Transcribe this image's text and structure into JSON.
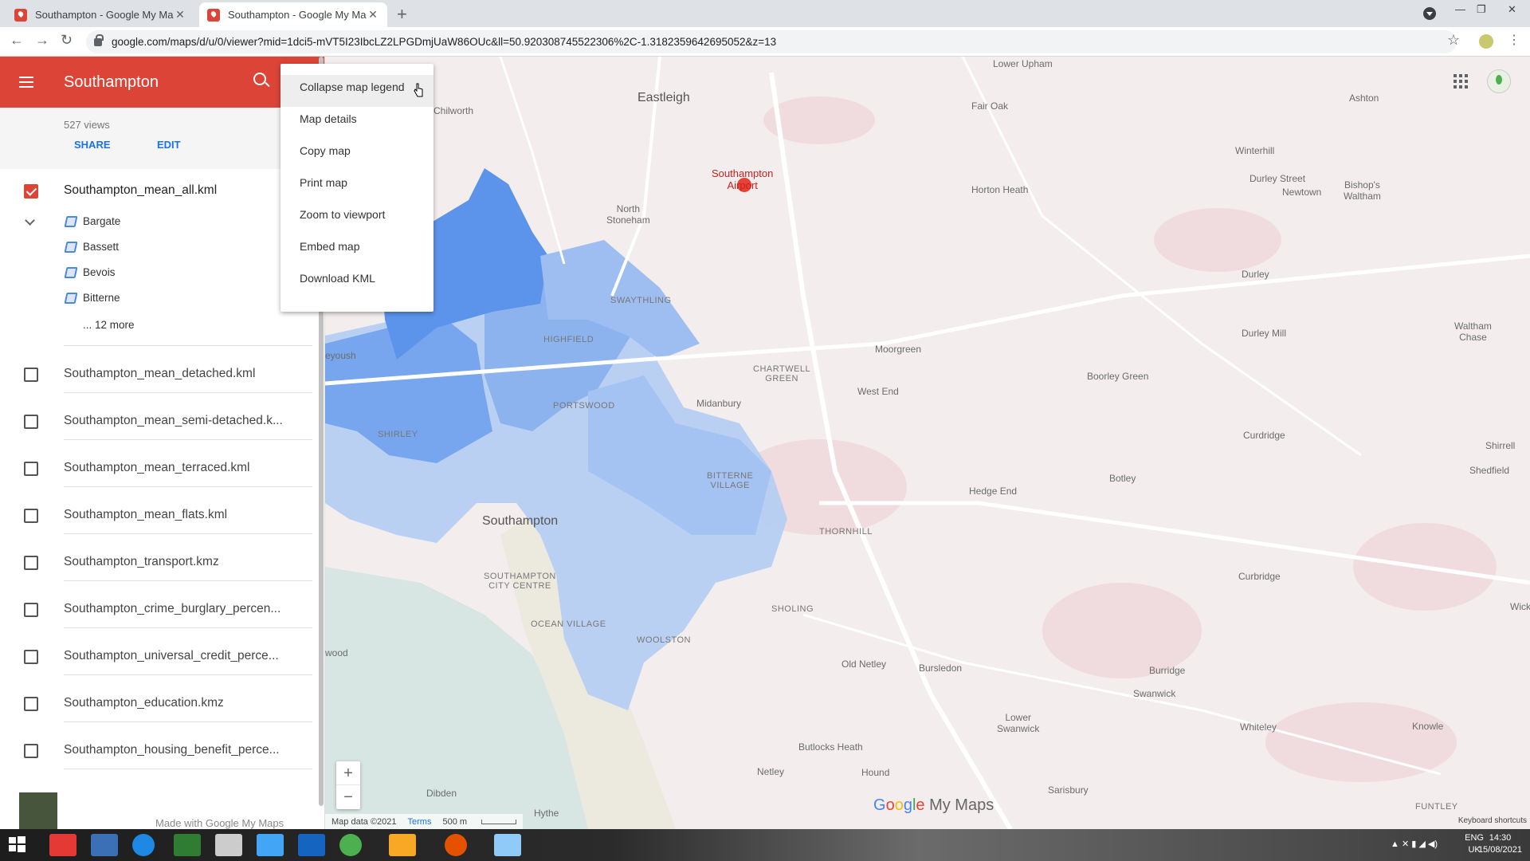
{
  "browser": {
    "tabs": [
      {
        "title": "Southampton - Google My Maps",
        "close": "✕"
      },
      {
        "title": "Southampton - Google My Maps",
        "close": "✕"
      }
    ],
    "new_tab": "+",
    "url": "google.com/maps/d/u/0/viewer?mid=1dci5-mVT5I23IbcLZ2LPGDmjUaW86OUc&ll=50.920308745522306%2C-1.3182359642695052&z=13",
    "back": "←",
    "forward": "→",
    "reload": "↻",
    "star": "☆",
    "menu": "⋮",
    "minimize": "—",
    "restore": "❐",
    "close": "✕"
  },
  "sidebar": {
    "title": "Southampton",
    "views": "527 views",
    "share_label": "SHARE",
    "edit_label": "EDIT",
    "layers": [
      {
        "name": "Southampton_mean_all.kml",
        "checked": true
      },
      {
        "name": "Southampton_mean_detached.kml",
        "checked": false
      },
      {
        "name": "Southampton_mean_semi-detached.k...",
        "checked": false
      },
      {
        "name": "Southampton_mean_terraced.kml",
        "checked": false
      },
      {
        "name": "Southampton_mean_flats.kml",
        "checked": false
      },
      {
        "name": "Southampton_transport.kmz",
        "checked": false
      },
      {
        "name": "Southampton_crime_burglary_percen...",
        "checked": false
      },
      {
        "name": "Southampton_universal_credit_perce...",
        "checked": false
      },
      {
        "name": "Southampton_education.kmz",
        "checked": false
      },
      {
        "name": "Southampton_housing_benefit_perce...",
        "checked": false
      }
    ],
    "features": [
      "Bargate",
      "Bassett",
      "Bevois",
      "Bitterne"
    ],
    "more_label": "... 12 more",
    "footer": "Made with Google My Maps"
  },
  "menu": {
    "items": [
      "Collapse map legend",
      "Map details",
      "Copy map",
      "Print map",
      "Zoom to viewport",
      "Embed map",
      "Download KML"
    ]
  },
  "map": {
    "labels": {
      "lower_upham": "Lower Upham",
      "eastleigh": "Eastleigh",
      "fair_oak": "Fair Oak",
      "ashton": "Ashton",
      "chilworth": "Chilworth",
      "winterhill": "Winterhill",
      "southampton_airport": "Southampton\nAirport",
      "durley_street": "Durley Street",
      "bishops_waltham": "Bishop's\nWaltham",
      "horton_heath": "Horton Heath",
      "newtown": "Newtown",
      "north_stoneham": "North\nStoneham",
      "durley": "Durley",
      "swaythling": "SWAYTHLING",
      "highfield": "HIGHFIELD",
      "durley_mill": "Durley Mill",
      "waltham_chase": "Waltham\nChase",
      "moorgreen": "Moorgreen",
      "chartwell_green": "CHARTWELL\nGREEN",
      "boorley_green": "Boorley Green",
      "west_end": "West End",
      "portswood": "PORTSWOOD",
      "midanbury": "Midanbury",
      "shirley": "SHIRLEY",
      "curdridge": "Curdridge",
      "shirrell": "Shirrell",
      "bitterne_village": "BITTERNE\nVILLAGE",
      "botley": "Botley",
      "shedfield": "Shedfield",
      "hedge_end": "Hedge End",
      "southampton": "Southampton",
      "thornhill": "THORNHILL",
      "curbridge": "Curbridge",
      "city_centre": "SOUTHAMPTON\nCITY CENTRE",
      "sholing": "SHOLING",
      "wick": "Wick",
      "ocean_village": "OCEAN VILLAGE",
      "woolston": "WOOLSTON",
      "old_netley": "Old Netley",
      "bursledon": "Bursledon",
      "burridge": "Burridge",
      "swanwick": "Swanwick",
      "lower_swanwick": "Lower\nSwanwick",
      "wood": "wood",
      "butlocks_heath": "Butlocks Heath",
      "whiteley": "Whiteley",
      "knowle": "Knowle",
      "netley": "Netley",
      "hound": "Hound",
      "dibden": "Dibden",
      "sarisbury": "Sarisbury",
      "hythe": "Hythe",
      "funtley": "FUNTLEY",
      "eyoush": "eyoush"
    },
    "zoom_in": "+",
    "zoom_out": "−",
    "logo_google": [
      "G",
      "o",
      "o",
      "g",
      "l",
      "e"
    ],
    "logo_suffix": " My Maps",
    "attribution": "Map data ©2021",
    "terms": "Terms",
    "scale": "500 m",
    "keyboard_shortcuts": "Keyboard shortcuts"
  },
  "taskbar": {
    "lang": "ENG\nUK",
    "time": "14:30",
    "date": "15/08/2021",
    "tray_icons": "▲ ✕ ▮ ◢ ◀)"
  },
  "colors": {
    "header_red": "#db4437",
    "region_dark": "#5b94ea",
    "region_mid": "#8db3ef",
    "region_light": "#b4cdf3",
    "link_blue": "#1a73e8"
  }
}
